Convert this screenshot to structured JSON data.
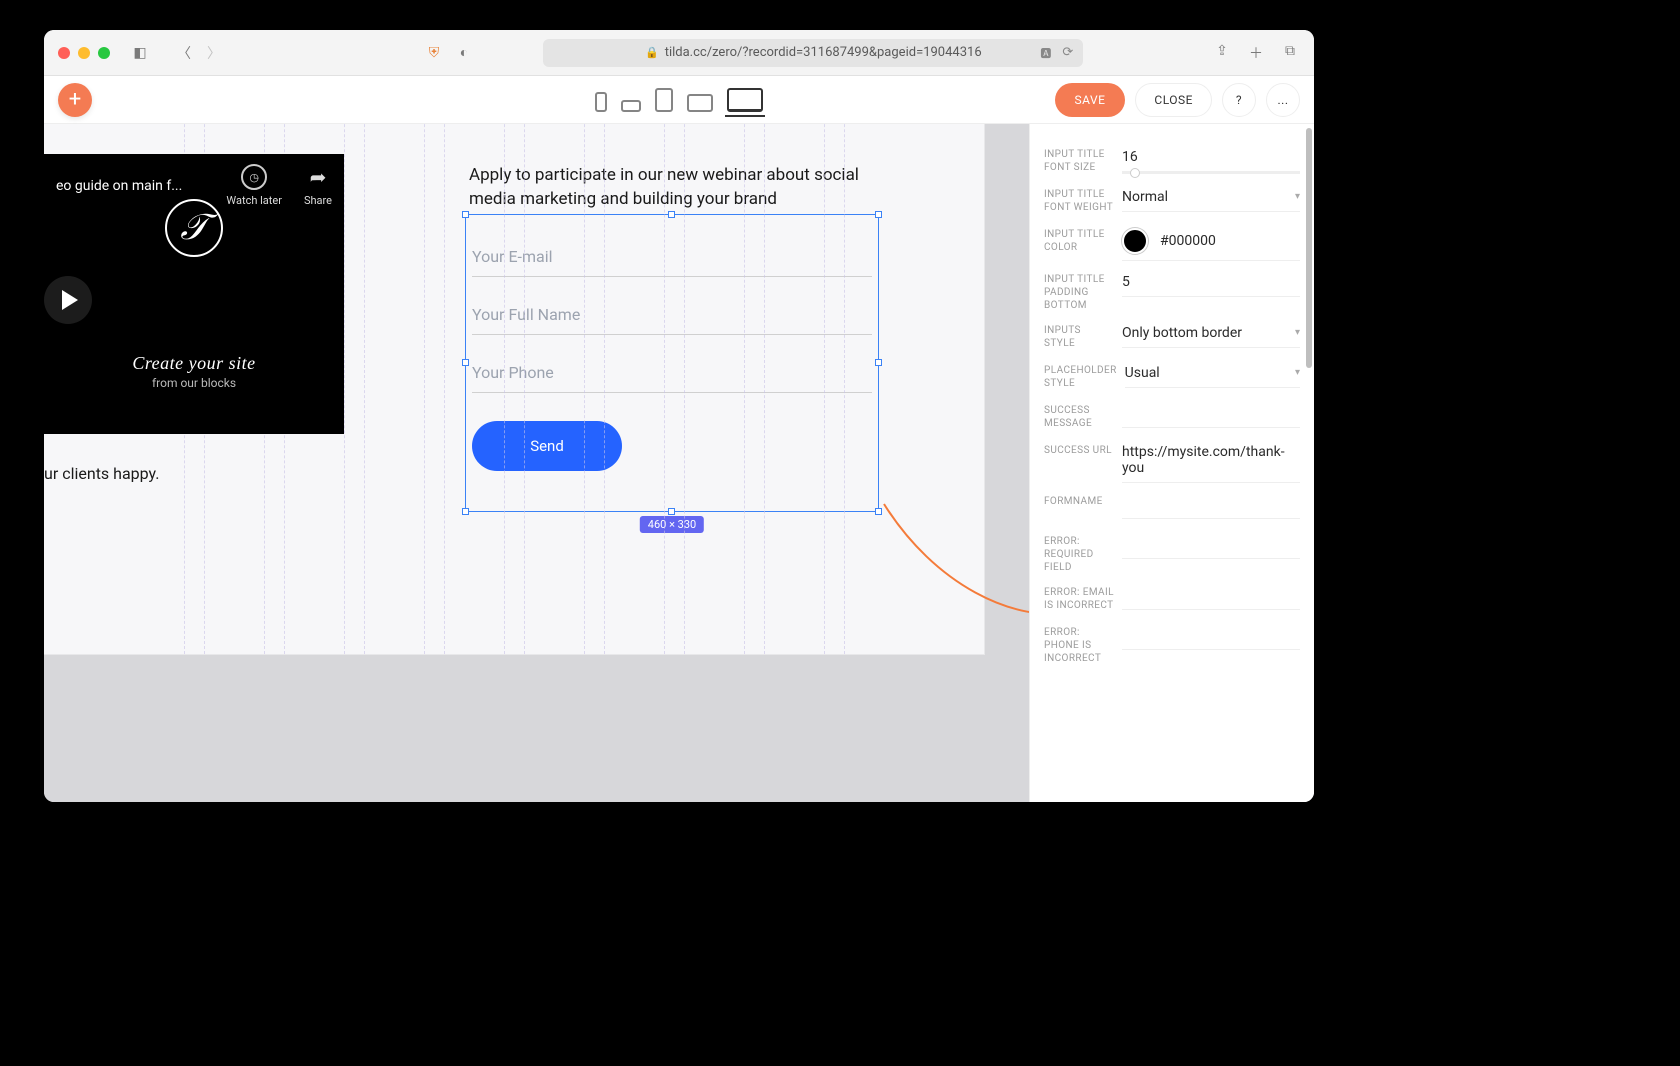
{
  "browser": {
    "url": "tilda.cc/zero/?recordid=311687499&pageid=19044316"
  },
  "toolbar": {
    "save": "SAVE",
    "close": "CLOSE",
    "help": "?",
    "more": "..."
  },
  "page": {
    "description": "Apply to participate in our new webinar about social media marketing and building your brand",
    "fields": {
      "email": "Your E-mail",
      "name": "Your Full Name",
      "phone": "Your Phone"
    },
    "submit": "Send",
    "clients_partial": "ur clients happy.",
    "selection_size": "460 × 330"
  },
  "video": {
    "title_partial": "eo guide on main f...",
    "watch_later": "Watch later",
    "share": "Share",
    "line1": "Create your site",
    "line2": "from our blocks"
  },
  "panel": {
    "items": [
      {
        "label": "INPUT TITLE FONT SIZE",
        "value": "16",
        "type": "slider"
      },
      {
        "label": "INPUT TITLE FONT WEIGHT",
        "value": "Normal",
        "type": "select"
      },
      {
        "label": "INPUT TITLE COLOR",
        "value": "#000000",
        "type": "color"
      },
      {
        "label": "INPUT TITLE PADDING BOTTOM",
        "value": "5",
        "type": "text"
      },
      {
        "label": "INPUTS STYLE",
        "value": "Only bottom border",
        "type": "select"
      },
      {
        "label": "PLACEHOLDER STYLE",
        "value": "Usual",
        "type": "select"
      },
      {
        "label": "SUCCESS MESSAGE",
        "value": "",
        "type": "text"
      },
      {
        "label": "SUCCESS URL",
        "value": "https://mysite.com/thank-you",
        "type": "text"
      },
      {
        "label": "FORMNAME",
        "value": "",
        "type": "text"
      },
      {
        "label": "ERROR: REQUIRED FIELD",
        "value": "",
        "type": "text"
      },
      {
        "label": "ERROR: EMAIL IS INCORRECT",
        "value": "",
        "type": "text"
      },
      {
        "label": "ERROR: PHONE IS INCORRECT",
        "value": "",
        "type": "text"
      }
    ]
  }
}
